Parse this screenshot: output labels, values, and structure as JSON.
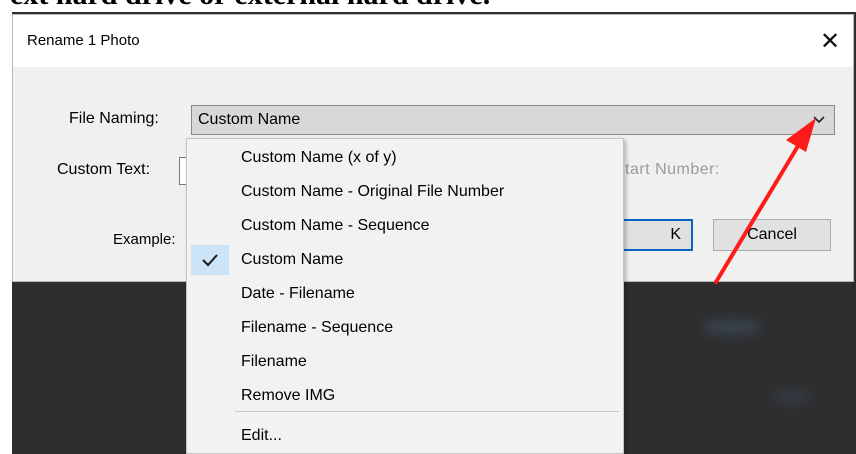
{
  "page": {
    "top_text": "ext hard drive or external hard drive."
  },
  "dialog": {
    "title": "Rename 1 Photo",
    "close_glyph": "✕",
    "file_naming_label": "File Naming:",
    "file_naming_value": "Custom Name",
    "custom_text_label": "Custom Text:",
    "start_number_label": "Start Number:",
    "start_number_visible": "tart Number:",
    "example_label": "Example:",
    "ok_label": "OK",
    "ok_visible": "K",
    "cancel_label": "Cancel",
    "cancel_visible": "ancel"
  },
  "dropdown": {
    "items": [
      {
        "label": "Custom Name (x of y)",
        "checked": false
      },
      {
        "label": "Custom Name - Original File Number",
        "checked": false
      },
      {
        "label": "Custom Name - Sequence",
        "checked": false
      },
      {
        "label": "Custom Name",
        "checked": true
      },
      {
        "label": "Date - Filename",
        "checked": false
      },
      {
        "label": "Filename - Sequence",
        "checked": false
      },
      {
        "label": "Filename",
        "checked": false
      },
      {
        "label": "Remove IMG",
        "checked": false
      },
      {
        "label": "Edit...",
        "checked": false
      }
    ]
  },
  "icons": {
    "close": "close-icon",
    "dropdown": "chevron-down-icon",
    "check": "checkmark-icon",
    "annotation": "red-arrow-annotation"
  },
  "colors": {
    "accent_blue": "#0b63c6",
    "check_highlight": "#cce4f7",
    "annotation_red": "#ff1a1a"
  }
}
